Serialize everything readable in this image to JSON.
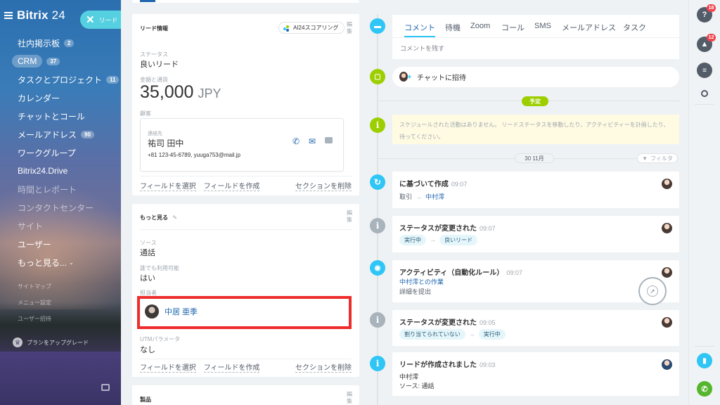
{
  "sidebar": {
    "logo": "Bitrix",
    "logo_num": "24",
    "lead_pill": "リード",
    "items": [
      {
        "label": "社内掲示板",
        "count": "2"
      },
      {
        "label": "CRM",
        "count": "37"
      },
      {
        "label": "タスクとプロジェクト",
        "count": "11"
      },
      {
        "label": "カレンダー",
        "count": ""
      },
      {
        "label": "チャットとコール",
        "count": ""
      },
      {
        "label": "メールアドレス",
        "count": "90"
      },
      {
        "label": "ワークグループ",
        "count": ""
      },
      {
        "label": "Bitrix24.Drive",
        "count": ""
      },
      {
        "label": "時間とレポート",
        "count": ""
      },
      {
        "label": "コンタクトセンター",
        "count": ""
      },
      {
        "label": "サイト",
        "count": ""
      },
      {
        "label": "ユーザー",
        "count": ""
      },
      {
        "label": "もっと見る...",
        "count": ""
      }
    ],
    "small_items": [
      "サイトマップ",
      "メニュー設定",
      "ユーザー招待"
    ],
    "upgrade": "プランをアップグレード"
  },
  "lead_info": {
    "title": "リード情報",
    "ai_badge": "AI24スコアリング",
    "edit": "編集",
    "status_label": "ステータス",
    "status_value": "良いリード",
    "amount_label": "金額と通貨",
    "amount_value": "35,000",
    "currency": "JPY",
    "client_label": "顧客",
    "contact_label": "連絡先",
    "contact_name": "祐司 田中",
    "contact_details": "+81 123-45-6789, yuuga753@mail.jp",
    "select_field": "フィールドを選択",
    "create_field": "フィールドを作成",
    "delete_section": "セクションを削除"
  },
  "more": {
    "title": "もっと見る",
    "edit": "編集",
    "source_label": "ソース",
    "source_value": "通話",
    "available_label": "誰でも利用可能",
    "available_value": "はい",
    "responsible_label": "担当者",
    "responsible_name": "中居 亜季",
    "utm_label": "UTMパラメータ",
    "utm_value": "なし",
    "select_field": "フィールドを選択",
    "create_field": "フィールドを作成",
    "delete_section": "セクションを削除"
  },
  "products": {
    "title": "製品",
    "edit": "編集"
  },
  "timeline": {
    "tabs": [
      "コメント",
      "待機",
      "Zoom",
      "コール",
      "SMS",
      "メールアドレス",
      "タスク"
    ],
    "comment_placeholder": "コメントを残す",
    "chat_invite": "チャットに招待",
    "planned": "予定",
    "empty_text": "スケジュールされた活動はありません。 リードステータスを移動したり、アクティビティーを計画したり、待ってください。",
    "date": "30 11月",
    "filter": "フィルタ",
    "events": [
      {
        "title": "に基づいて作成",
        "time": "09:07",
        "from": "取引",
        "to": "中村澪"
      },
      {
        "title": "ステータスが変更された",
        "time": "09:07",
        "from": "実行中",
        "to": "良いリード"
      },
      {
        "title": "アクティビティ（自動化ルール）",
        "time": "09:07",
        "line1": "中村澪との作業",
        "line2": "詳細を提出"
      },
      {
        "title": "ステータスが変更された",
        "time": "09:05",
        "from": "割り当てられていない",
        "to": "実行中"
      },
      {
        "title": "リードが作成されました",
        "time": "09:03",
        "line1": "中村澪",
        "line2": "ソース: 通話"
      }
    ]
  },
  "rail": {
    "help_badge": "18",
    "notif_badge": "12"
  },
  "colors": {
    "accent": "#2fc6f6",
    "highlight": "#ee2c2c",
    "green": "#9dcf00",
    "grey": "#a8b3bc",
    "link": "#2067b0"
  }
}
